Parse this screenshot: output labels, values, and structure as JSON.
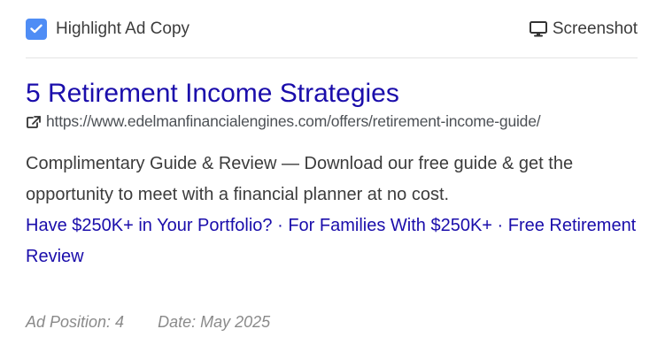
{
  "topbar": {
    "highlight_label": "Highlight Ad Copy",
    "screenshot_label": "Screenshot",
    "checkbox_checked": true,
    "accent_color": "#4f8df5"
  },
  "ad": {
    "title": "5 Retirement Income Strategies",
    "url": "https://www.edelmanfinancialengines.com/offers/retirement-income-guide/",
    "description": "Complimentary Guide & Review — Download our free guide & get the opportunity to meet with a financial planner at no cost.",
    "sitelinks": [
      "Have $250K+ in Your Portfolio?",
      "For Families With $250K+",
      "Free Retirement Review"
    ],
    "separator": " · ",
    "link_color": "#1a0dab"
  },
  "meta": {
    "position": "Ad Position: 4",
    "date": "Date: May 2025"
  },
  "icons": {
    "checkbox": "check-icon",
    "screenshot": "monitor-icon",
    "url": "external-link-icon"
  }
}
